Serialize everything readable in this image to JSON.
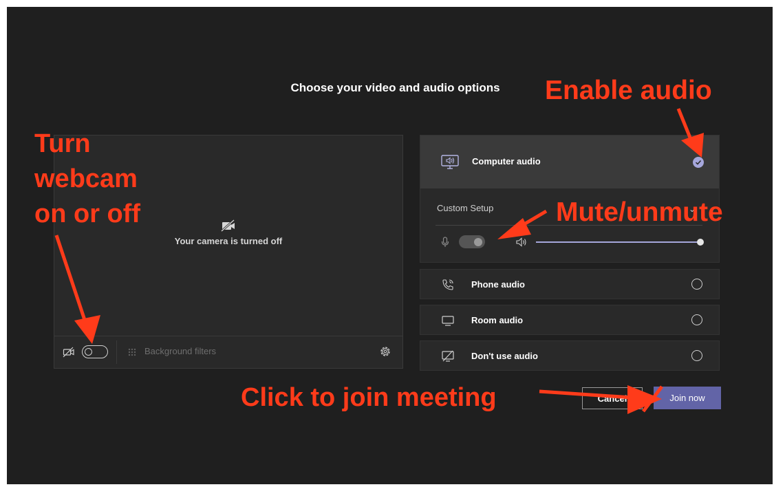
{
  "dialog": {
    "title": "Choose your video and audio options"
  },
  "video": {
    "camera_status": "Your camera is turned off",
    "camera_toggle_on": false,
    "background_filters_label": "Background filters"
  },
  "audio": {
    "computer_audio": {
      "label": "Computer audio",
      "selected": true,
      "custom_setup_label": "Custom Setup",
      "mic_toggle_on": false,
      "speaker_volume_percent": 100
    },
    "phone_audio": {
      "label": "Phone audio",
      "selected": false
    },
    "room_audio": {
      "label": "Room audio",
      "selected": false
    },
    "no_audio": {
      "label": "Don't use audio",
      "selected": false
    }
  },
  "actions": {
    "cancel_label": "Cancel",
    "join_label": "Join now"
  },
  "annotations": {
    "webcam_line1": "Turn",
    "webcam_line2": "webcam",
    "webcam_line3": "on or off",
    "enable_audio": "Enable audio",
    "mute_unmute": "Mute/unmute",
    "join_meeting": "Click to join meeting"
  },
  "colors": {
    "background": "#1f1f1f",
    "panel": "#292929",
    "accent": "#6264a7",
    "check": "#a6a7dc",
    "annotation": "#ff3b1a"
  }
}
